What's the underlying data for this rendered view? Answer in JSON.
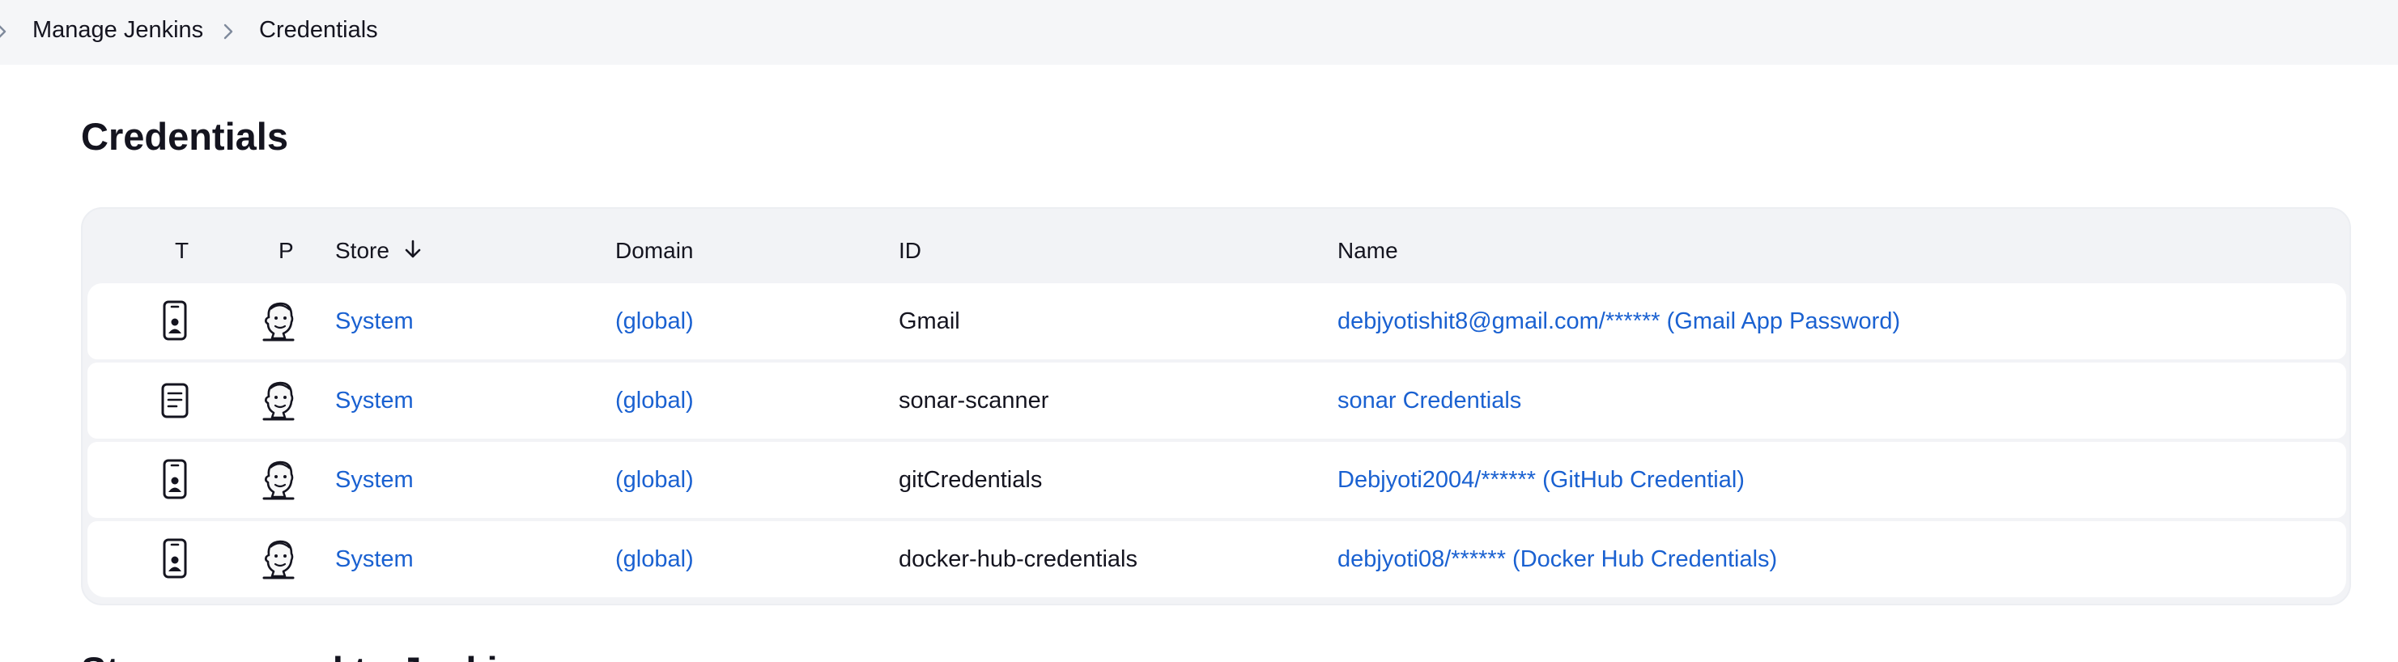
{
  "breadcrumb": {
    "items": [
      "Manage Jenkins",
      "Credentials"
    ]
  },
  "page": {
    "title": "Credentials",
    "next_section_title": "Stores scoped to Jenkins"
  },
  "table": {
    "columns": {
      "type": "T",
      "provider": "P",
      "store": "Store",
      "store_sort_icon": "arrow-down-icon",
      "domain": "Domain",
      "id": "ID",
      "name": "Name"
    },
    "rows": [
      {
        "type_icon": "username-password-icon",
        "provider_icon": "jenkins-icon",
        "store": "System",
        "domain": "(global)",
        "id": "Gmail",
        "name": "debjyotishit8@gmail.com/****** (Gmail App Password)"
      },
      {
        "type_icon": "secret-text-icon",
        "provider_icon": "jenkins-icon",
        "store": "System",
        "domain": "(global)",
        "id": "sonar-scanner",
        "name": "sonar Credentials"
      },
      {
        "type_icon": "username-password-icon",
        "provider_icon": "jenkins-icon",
        "store": "System",
        "domain": "(global)",
        "id": "gitCredentials",
        "name": "Debjyoti2004/****** (GitHub Credential)"
      },
      {
        "type_icon": "username-password-icon",
        "provider_icon": "jenkins-icon",
        "store": "System",
        "domain": "(global)",
        "id": "docker-hub-credentials",
        "name": "debjyoti08/****** (Docker Hub Credentials)"
      }
    ]
  },
  "colors": {
    "link": "#1a61d1",
    "header_bg": "#f5f6f8",
    "table_bg": "#f2f3f6",
    "text": "#14141f"
  }
}
